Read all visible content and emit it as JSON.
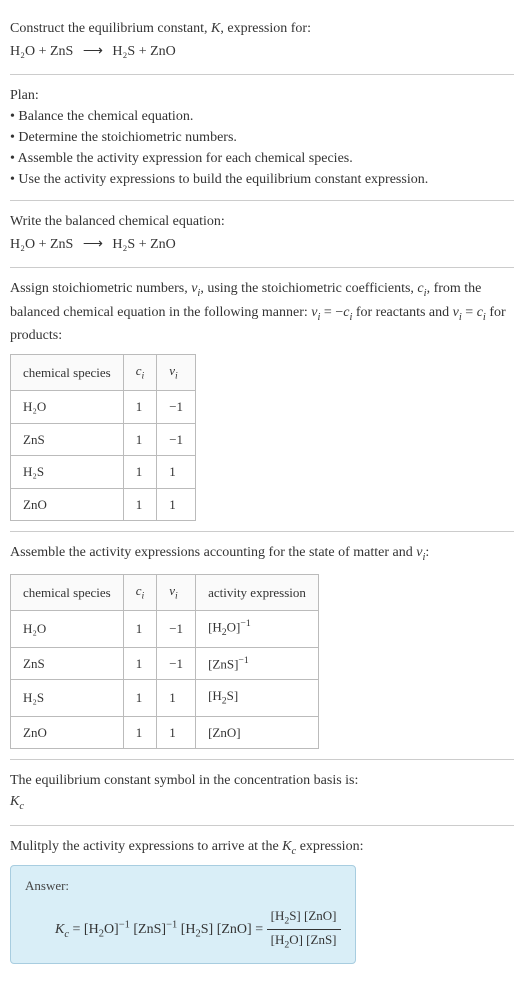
{
  "intro": {
    "line1": "Construct the equilibrium constant, K, expression for:",
    "equation_lhs": "H₂O + ZnS",
    "equation_arrow": "⟶",
    "equation_rhs": "H₂S + ZnO"
  },
  "plan": {
    "heading": "Plan:",
    "items": [
      "• Balance the chemical equation.",
      "• Determine the stoichiometric numbers.",
      "• Assemble the activity expression for each chemical species.",
      "• Use the activity expressions to build the equilibrium constant expression."
    ]
  },
  "balanced": {
    "heading": "Write the balanced chemical equation:",
    "equation_lhs": "H₂O + ZnS",
    "equation_arrow": "⟶",
    "equation_rhs": "H₂S + ZnO"
  },
  "stoich": {
    "text": "Assign stoichiometric numbers, νᵢ, using the stoichiometric coefficients, cᵢ, from the balanced chemical equation in the following manner: νᵢ = −cᵢ for reactants and νᵢ = cᵢ for products:",
    "headers": {
      "species": "chemical species",
      "ci": "cᵢ",
      "vi": "νᵢ"
    },
    "rows": [
      {
        "species": "H₂O",
        "ci": "1",
        "vi": "−1"
      },
      {
        "species": "ZnS",
        "ci": "1",
        "vi": "−1"
      },
      {
        "species": "H₂S",
        "ci": "1",
        "vi": "1"
      },
      {
        "species": "ZnO",
        "ci": "1",
        "vi": "1"
      }
    ]
  },
  "activity": {
    "text": "Assemble the activity expressions accounting for the state of matter and νᵢ:",
    "headers": {
      "species": "chemical species",
      "ci": "cᵢ",
      "vi": "νᵢ",
      "expr": "activity expression"
    },
    "rows": [
      {
        "species": "H₂O",
        "ci": "1",
        "vi": "−1",
        "expr": "[H₂O]⁻¹"
      },
      {
        "species": "ZnS",
        "ci": "1",
        "vi": "−1",
        "expr": "[ZnS]⁻¹"
      },
      {
        "species": "H₂S",
        "ci": "1",
        "vi": "1",
        "expr": "[H₂S]"
      },
      {
        "species": "ZnO",
        "ci": "1",
        "vi": "1",
        "expr": "[ZnO]"
      }
    ]
  },
  "symbol_section": {
    "line1": "The equilibrium constant symbol in the concentration basis is:",
    "symbol": "K_c"
  },
  "final": {
    "heading": "Mulitply the activity expressions to arrive at the K_c expression:",
    "answer_label": "Answer:",
    "kc_prefix": "K_c = ",
    "product_expr": "[H₂O]⁻¹ [ZnS]⁻¹ [H₂S] [ZnO] = ",
    "frac_num": "[H₂S] [ZnO]",
    "frac_den": "[H₂O] [ZnS]"
  }
}
